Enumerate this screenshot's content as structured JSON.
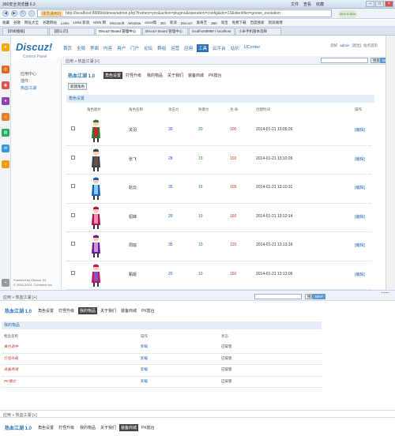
{
  "browser": {
    "title": "360安全浏览器 6.3",
    "menu": [
      "文件",
      "查看",
      "收藏"
    ],
    "url_tag": "球员通用社",
    "url": "http://localhost:8888/dzbnew/admin.php?frames=yes&action=plugins&operation=config&do=13&identifier=goose_evolution",
    "speed": "3K/s 0.3K/s",
    "bookmarks": [
      "收藏",
      "谷歌",
      "网址大全",
      "谷歌网站",
      "Links",
      "Links 新浪",
      "MSN 网",
      "Microsoft",
      "Window",
      "excel帮",
      "BO",
      "新浪",
      "Discuz!",
      "爱奇艺",
      "360",
      "淘宝",
      "免费下载",
      "百度搜索",
      "新浪微博"
    ],
    "tabs": [
      {
        "label": "【新闻播报】",
        "active": false
      },
      {
        "label": "【圆认识】",
        "active": false
      },
      {
        "label": "Discuz! Board 管理中心",
        "active": true
      },
      {
        "label": "Discuz! Board 管理中心",
        "active": false
      },
      {
        "label": "localhost8888 / localhost",
        "active": false
      },
      {
        "label": "小米手机版本选择",
        "active": false
      }
    ]
  },
  "admin": {
    "logo": "Discuz!",
    "logo_sub": "Control Panel",
    "nav": [
      {
        "label": "首页",
        "on": false
      },
      {
        "label": "全局",
        "on": false
      },
      {
        "label": "界面",
        "on": false
      },
      {
        "label": "内容",
        "on": false
      },
      {
        "label": "用户",
        "on": false
      },
      {
        "label": "门户",
        "on": false
      },
      {
        "label": "论坛",
        "on": false
      },
      {
        "label": "群组",
        "on": false
      },
      {
        "label": "运营",
        "on": false
      },
      {
        "label": "应用",
        "on": false
      },
      {
        "label": "工具",
        "on": true
      },
      {
        "label": "云平台",
        "on": false
      },
      {
        "label": "站长",
        "on": false
      },
      {
        "label": "UCenter",
        "on": false
      }
    ],
    "top_links": [
      "您好",
      "admin",
      "[退出]",
      "站点首页"
    ],
    "left_items": [
      "应用中心",
      "插件",
      "热血江湖"
    ],
    "breadcrumb": "应用 » 热血江湖 [+]",
    "search_button": "搜索",
    "map_button": "MAP",
    "powered": "Powered by Discuz! X3",
    "copyright": "© 2001-2013, Comsenz Inc."
  },
  "plugin": {
    "title": "热血江湖 1.0",
    "tabs": [
      {
        "label": "角色设置",
        "on": true
      },
      {
        "label": "打怪升级",
        "on": false
      },
      {
        "label": "我的物品",
        "on": false
      },
      {
        "label": "关于我们",
        "on": false
      },
      {
        "label": "装备商城",
        "on": false
      },
      {
        "label": "PK擂台",
        "on": false
      }
    ],
    "new_button": "新建角色",
    "section": "角色设置",
    "columns": [
      "角色图片",
      "角色名称",
      "攻击力",
      "防御力",
      "生 命",
      "创建时间",
      "操作"
    ],
    "rows": [
      {
        "name": "关羽",
        "atk": "30",
        "def": "20",
        "hp": "100",
        "time": "2014-01-21 13:05:26",
        "op": "[编辑]"
      },
      {
        "name": "张飞",
        "atk": "28",
        "def": "19",
        "hp": "102",
        "time": "2014-01-21 13:10:26",
        "op": "[编辑]"
      },
      {
        "name": "赵云",
        "atk": "35",
        "def": "15",
        "hp": "105",
        "time": "2014-01-21 13:10:31",
        "op": "[编辑]"
      },
      {
        "name": "貂蝉",
        "atk": "20",
        "def": "10",
        "hp": "150",
        "time": "2014-01-21 13:12:14",
        "op": "[编辑]"
      },
      {
        "name": "周瑜",
        "atk": "35",
        "def": "10",
        "hp": "120",
        "time": "2014-01-21 13:13:16",
        "op": "[编辑]"
      },
      {
        "name": "甄姬",
        "atk": "20",
        "def": "10",
        "hp": "150",
        "time": "2014-01-21 13:13:09",
        "op": "[编辑]"
      }
    ]
  },
  "status": {
    "zoom": "100%"
  },
  "second": {
    "breadcrumb": "应用 » 热血江湖 [+]",
    "title": "热血江湖 1.0",
    "tabs": [
      {
        "label": "角色设置",
        "on": false
      },
      {
        "label": "打怪升级",
        "on": false
      },
      {
        "label": "我的物品",
        "on": true
      },
      {
        "label": "关于我们",
        "on": false
      },
      {
        "label": "装备商城",
        "on": false
      },
      {
        "label": "PK擂台",
        "on": false
      }
    ],
    "section": "我的物品",
    "columns": [
      "物品名称",
      "操作",
      "状态"
    ],
    "rows": [
      {
        "name": "角色选中",
        "op": "卸载",
        "status": "已穿装"
      },
      {
        "name": "打怪升级",
        "op": "卸载",
        "status": "已穿装"
      },
      {
        "name": "装备商城",
        "op": "卸载",
        "status": "已穿装"
      },
      {
        "name": "PK擂台",
        "op": "卸载",
        "status": "已穿装"
      }
    ]
  },
  "third": {
    "breadcrumb": "应用 » 热血江湖 [+]",
    "title": "热血江湖 1.0",
    "tabs": [
      {
        "label": "角色设置",
        "on": false
      },
      {
        "label": "打怪升级",
        "on": false
      },
      {
        "label": "我的物品",
        "on": false
      },
      {
        "label": "关于我们",
        "on": false
      },
      {
        "label": "装备商城",
        "on": true
      },
      {
        "label": "PK擂台",
        "on": false
      }
    ]
  }
}
